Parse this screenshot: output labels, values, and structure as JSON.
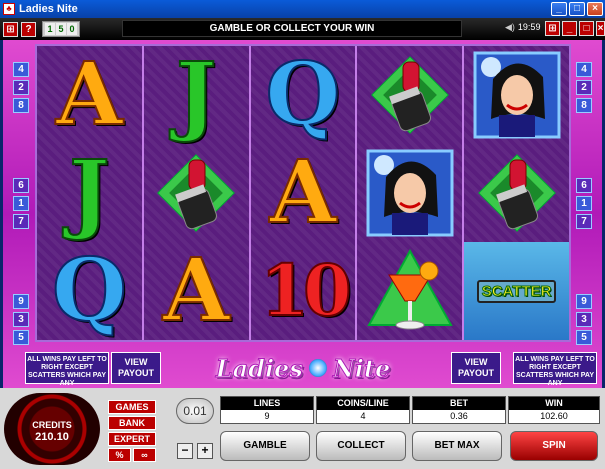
{
  "window": {
    "title": "Ladies Nite",
    "min": "_",
    "max": "□",
    "close": "×"
  },
  "toolbar": {
    "btn1": "⊞",
    "btn2": "?",
    "grp": [
      "1",
      "5",
      "0"
    ],
    "message": "GAMBLE OR COLLECT YOUR WIN",
    "clock": "19:59",
    "right_buttons": [
      "⊞",
      "_",
      "□",
      "×"
    ]
  },
  "paylines_left": [
    "4",
    "2",
    "8",
    "6",
    "1",
    "7",
    "9",
    "3",
    "5"
  ],
  "paylines_right": [
    "4",
    "2",
    "8",
    "6",
    "1",
    "7",
    "9",
    "3",
    "5"
  ],
  "reels": [
    [
      "A",
      "J",
      "Q"
    ],
    [
      "J",
      "lipstick",
      "A"
    ],
    [
      "Q",
      "A",
      "10"
    ],
    [
      "lipstick",
      "lady",
      "cocktail"
    ],
    [
      "lady",
      "lipstick",
      "SCATTER"
    ]
  ],
  "panel": {
    "info_left": "ALL WINS PAY LEFT TO RIGHT EXCEPT SCATTERS WHICH PAY ANY",
    "info_right": "ALL WINS PAY LEFT TO RIGHT EXCEPT SCATTERS WHICH PAY ANY",
    "view_payout": "VIEW PAYOUT",
    "logo_left": "Ladies",
    "logo_right": "Nite"
  },
  "console": {
    "credits_label": "CREDITS",
    "credits_value": "210.10",
    "games": "GAMES",
    "bank": "BANK",
    "expert": "EXPERT",
    "pct": "%",
    "oo": "∞",
    "coin_value": "0.01",
    "minus": "−",
    "plus": "+",
    "lines_label": "LINES",
    "lines_value": "9",
    "coins_label": "COINS/LINE",
    "coins_value": "4",
    "bet_label": "BET",
    "bet_value": "0.36",
    "win_label": "WIN",
    "win_value": "102.60",
    "gamble": "GAMBLE",
    "collect": "COLLECT",
    "betmax": "BET MAX",
    "spin": "SPIN"
  }
}
